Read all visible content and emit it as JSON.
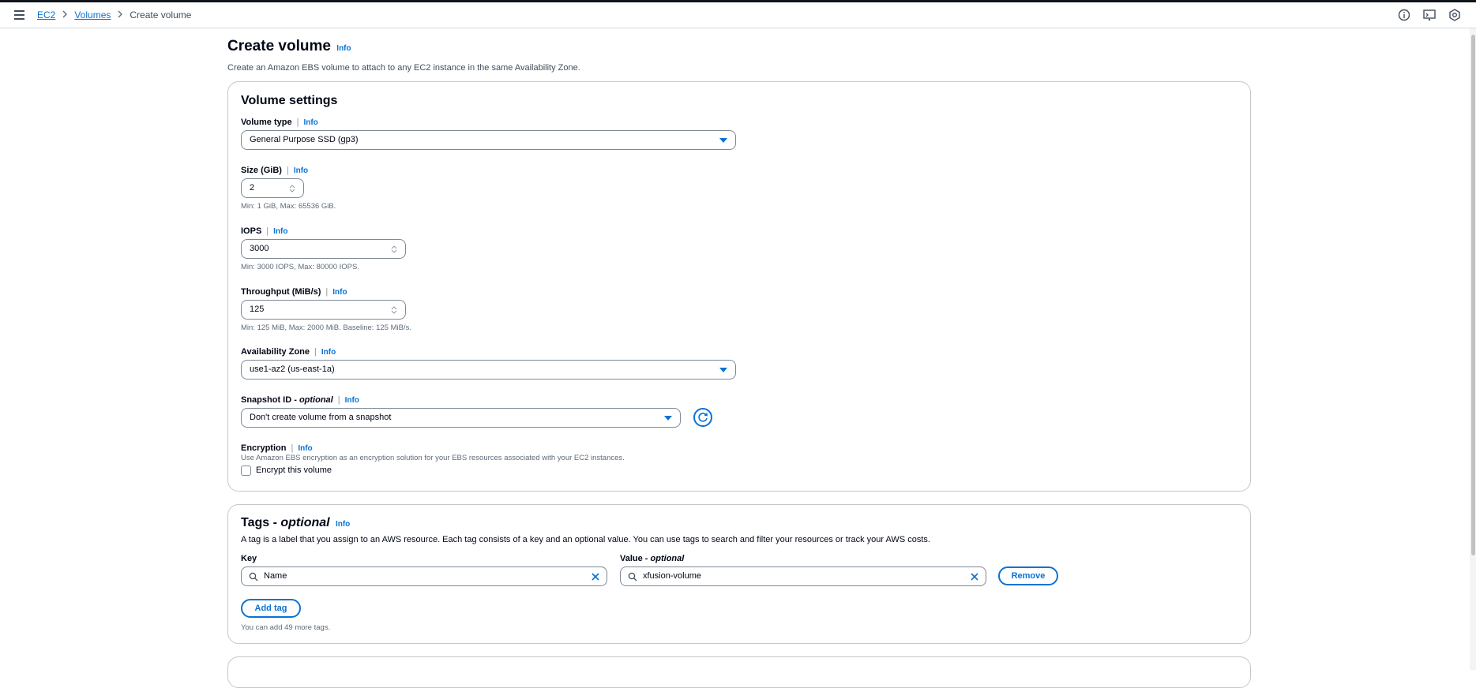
{
  "breadcrumb": {
    "items": [
      "EC2",
      "Volumes"
    ],
    "current": "Create volume"
  },
  "header": {
    "title": "Create volume",
    "info": "Info",
    "description": "Create an Amazon EBS volume to attach to any EC2 instance in the same Availability Zone."
  },
  "volume_settings": {
    "title": "Volume settings",
    "volume_type": {
      "label": "Volume type",
      "info": "Info",
      "value": "General Purpose SSD (gp3)"
    },
    "size": {
      "label": "Size (GiB)",
      "info": "Info",
      "value": "2",
      "hint": "Min: 1 GiB, Max: 65536 GiB."
    },
    "iops": {
      "label": "IOPS",
      "info": "Info",
      "value": "3000",
      "hint": "Min: 3000 IOPS, Max: 80000 IOPS."
    },
    "throughput": {
      "label": "Throughput (MiB/s)",
      "info": "Info",
      "value": "125",
      "hint": "Min: 125 MiB, Max: 2000 MiB. Baseline: 125 MiB/s."
    },
    "availability_zone": {
      "label": "Availability Zone",
      "info": "Info",
      "value": "use1-az2 (us-east-1a)"
    },
    "snapshot": {
      "label": "Snapshot ID - ",
      "label_optional": "optional",
      "info": "Info",
      "value": "Don't create volume from a snapshot"
    },
    "encryption": {
      "label": "Encryption",
      "info": "Info",
      "description": "Use Amazon EBS encryption as an encryption solution for your EBS resources associated with your EC2 instances.",
      "checkbox_label": "Encrypt this volume"
    }
  },
  "tags": {
    "title": "Tags - ",
    "title_optional": "optional",
    "info": "Info",
    "description": "A tag is a label that you assign to an AWS resource. Each tag consists of a key and an optional value. You can use tags to search and filter your resources or track your AWS costs.",
    "key_label": "Key",
    "value_label": "Value - ",
    "value_label_optional": "optional",
    "key_value": "Name",
    "value_value": "xfusion-volume",
    "remove_label": "Remove",
    "add_tag_label": "Add tag",
    "remaining": "You can add 49 more tags."
  },
  "colors": {
    "accent": "#0972d3",
    "text": "#000716",
    "border": "#7d8998"
  }
}
